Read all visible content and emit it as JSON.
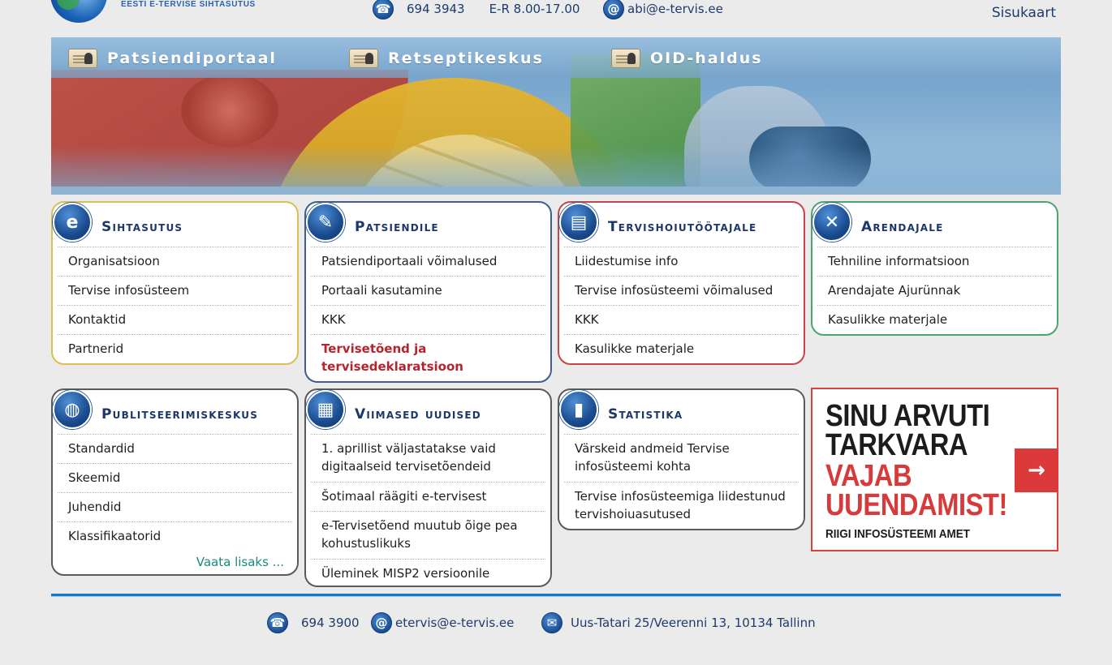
{
  "header": {
    "org_name": "EESTI E-TERVISE SIHTASUTUS",
    "phone": "694 3943",
    "hours": "E-R 8.00-17.00",
    "email": "abi@e-tervis.ee",
    "sitemap": "Sisukaart",
    "phone_icon": "phone-icon",
    "email_icon": "at-icon"
  },
  "banner": {
    "links": [
      {
        "label": "Patsiendiportaal",
        "icon": "id-card-icon"
      },
      {
        "label": "Retseptikeskus",
        "icon": "id-card-icon"
      },
      {
        "label": "OID-haldus",
        "icon": "id-card-icon"
      }
    ]
  },
  "cards": {
    "sihtasutus": {
      "title": "Sihtasutus",
      "icon": "e-logo-icon",
      "items": [
        "Organisatsioon",
        "Tervise infosüsteem",
        "Kontaktid",
        "Partnerid"
      ]
    },
    "patsiendile": {
      "title": "Patsiendile",
      "icon": "patient-document-icon",
      "items": [
        "Patsiendiportaali võimalused",
        "Portaali kasutamine",
        "KKK"
      ],
      "highlight": "Tervisetõend ja tervisedeklaratsioon"
    },
    "tervishoiutootajale": {
      "title": "Tervishoiutöötajale",
      "icon": "id-badge-icon",
      "items": [
        "Liidestumise info",
        "Tervise infosüsteemi võimalused",
        "KKK",
        "Kasulikke materjale"
      ]
    },
    "arendajale": {
      "title": "Arendajale",
      "icon": "tools-icon",
      "items": [
        "Tehniline informatsioon",
        "Arendajate Ajurünnak",
        "Kasulikke materjale"
      ]
    },
    "publitseerimiskeskus": {
      "title": "Publitseerimiskeskus",
      "icon": "globe-icon",
      "items": [
        "Standardid",
        "Skeemid",
        "Juhendid",
        "Klassifikaatorid"
      ],
      "more": "Vaata lisaks ..."
    },
    "uudised": {
      "title": "Viimased uudised",
      "icon": "newspaper-icon",
      "items": [
        "1. aprillist väljastatakse vaid digitaalseid tervisetõendeid",
        "Šotimaal räägiti e-tervisest",
        "e-Tervisetõend muutub õige pea kohustuslikuks",
        "Üleminek MISP2 versioonile"
      ]
    },
    "statistika": {
      "title": "Statistika",
      "icon": "bar-chart-icon",
      "items": [
        "Värskeid andmeid Tervise infosüsteemi kohta",
        "Tervise infosüsteemiga liidestunud tervishoiuasutused"
      ]
    }
  },
  "ad": {
    "line1": "SINU ARVUTI",
    "line2": "TARKVARA",
    "line3": "VAJAB",
    "line4": "UUENDAMIST!",
    "footer": "RIIGI INFOSÜSTEEMI AMET",
    "arrow_icon": "arrow-right-icon",
    "dark_color": "#1c1c1c",
    "accent_color": "#d63a3a"
  },
  "footer": {
    "phone": "694 3900",
    "email": "etervis@e-tervis.ee",
    "address": "Uus-Tatari 25/Veerenni 13, 10134 Tallinn"
  }
}
